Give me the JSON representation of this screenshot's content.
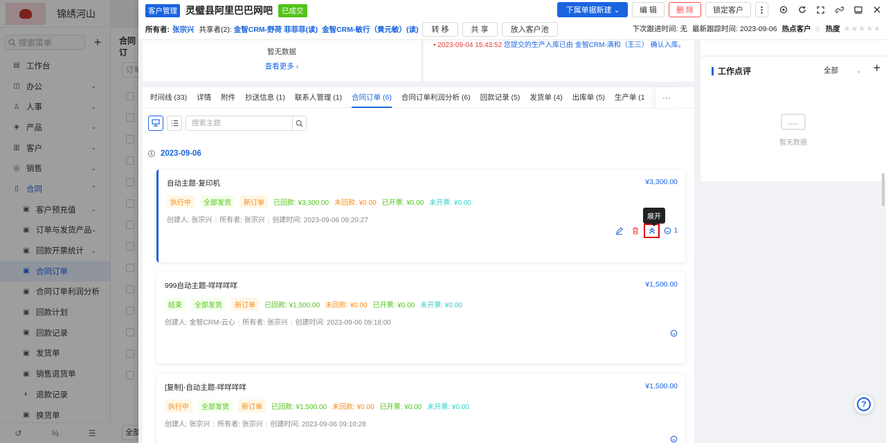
{
  "leftnav": {
    "brand": "锦绣河山",
    "search_placeholder": "搜索菜单",
    "items": [
      {
        "label": "工作台",
        "icon": "▤"
      },
      {
        "label": "办公",
        "icon": "◫",
        "chev": "⌄"
      },
      {
        "label": "人事",
        "icon": "♙",
        "chev": "⌄"
      },
      {
        "label": "产品",
        "icon": "◈",
        "chev": "⌄"
      },
      {
        "label": "客户",
        "icon": "▥",
        "chev": "⌄"
      },
      {
        "label": "销售",
        "icon": "◎",
        "chev": "⌄"
      },
      {
        "label": "合同",
        "icon": "▯",
        "chev": "⌃"
      },
      {
        "label": "客户预充值",
        "icon": "▣",
        "chev": "⌄"
      },
      {
        "label": "订单与发货产品",
        "icon": "▣",
        "chev": "⌄"
      },
      {
        "label": "回款开票统计",
        "icon": "▣",
        "chev": "⌄"
      },
      {
        "label": "合同订单",
        "icon": "▣"
      },
      {
        "label": "合同订单利润分析",
        "icon": "▣"
      },
      {
        "label": "回款计划",
        "icon": "▣"
      },
      {
        "label": "回款记录",
        "icon": "▣"
      },
      {
        "label": "发货单",
        "icon": "▣"
      },
      {
        "label": "销售退货单",
        "icon": "▣"
      },
      {
        "label": "退款记录",
        "icon": "◐"
      },
      {
        "label": "换货单",
        "icon": "▣"
      }
    ],
    "bottom": [
      "↺",
      "⅓",
      "☰"
    ]
  },
  "bg": {
    "title": "合同订",
    "search": "订单",
    "page": "全部"
  },
  "header": {
    "module_tag": "客户管理",
    "customer_name": "灵璧县阿里巴巴网吧",
    "status_tag": "已成交",
    "btn_new": "下属单据新建 ⌄",
    "btn_edit": "编 辑",
    "btn_delete": "删 除",
    "btn_lock": "锁定客户",
    "owner_label": "所有者:",
    "owner": "张宗兴",
    "shared_label": "共享者(2):",
    "shared1": "金智CRM-野荷 菲菲菲(读)",
    "shared2": "金智CRM-敏行（黄元敏）(读)",
    "btn_transfer": "转 移",
    "btn_share": "共 享",
    "btn_pool": "放入客户池",
    "next_follow_label": "下次跟进时间:",
    "next_follow": "无",
    "last_follow_label": "最新跟踪时间:",
    "last_follow": "2023-09-06",
    "hot_label": "热点客户",
    "heat_label": "热度"
  },
  "top_cards": {
    "nodata": "暂无数据",
    "more": "查看更多 ›",
    "log_time": "• 2023-09-04 15:43:52",
    "log_text1": "您提交的生产入库已由",
    "log_text2": "金智CRM-满和（王三）",
    "log_text3": "确认入库。"
  },
  "tabs": [
    "时间线 (33)",
    "详情",
    "附件",
    "抄送信息 (1)",
    "联系人管理 (1)",
    "合同订单 (6)",
    "合同订单利润分析 (6)",
    "回款记录 (5)",
    "发货单 (4)",
    "出库单 (5)",
    "生产单 (1"
  ],
  "toolbar": {
    "search_placeholder": "搜索主题"
  },
  "timeline": {
    "date": "2023-09-06"
  },
  "orders": [
    {
      "subject": "自动主题-复印机",
      "amount": "¥3,300.00",
      "status": "执行中",
      "ship": "全部发货",
      "type": "新订单",
      "received": "已回款: ¥3,300.00",
      "unreceived": "未回款: ¥0.00",
      "invoiced": "已开票: ¥0.00",
      "uninvoiced": "未开票: ¥0.00",
      "creator": "创建人: 张宗兴",
      "owner": "所有者: 张宗兴",
      "created": "创建时间: 2023-09-06 09:20:27",
      "comments": "1"
    },
    {
      "subject": "999自动主题-咩咩咩咩",
      "amount": "¥1,500.00",
      "status": "结束",
      "ship": "全部发货",
      "type": "新订单",
      "received": "已回款: ¥1,500.00",
      "unreceived": "未回款: ¥0.00",
      "invoiced": "已开票: ¥0.00",
      "uninvoiced": "未开票: ¥0.00",
      "creator": "创建人: 金智CRM-云心",
      "owner": "所有者: 张宗兴",
      "created": "创建时间: 2023-09-06 09:18:00"
    },
    {
      "subject": "[复制]-自动主题-咩咩咩咩",
      "amount": "¥1,500.00",
      "status": "执行中",
      "ship": "全部发货",
      "type": "新订单",
      "received": "已回款: ¥1,500.00",
      "unreceived": "未回款: ¥0.00",
      "invoiced": "已开票: ¥0.00",
      "uninvoiced": "未开票: ¥0.00",
      "creator": "创建人: 张宗兴",
      "owner": "所有者: 张宗兴",
      "created": "创建时间: 2023-09-06 09:10:28"
    }
  ],
  "tooltip": "展开",
  "right_panel": {
    "title": "工作点评",
    "filter": "全部",
    "empty": "暂无数据"
  },
  "colors": {
    "accent": "#1a64e0",
    "danger": "#ff4d4f",
    "success": "#52c41a",
    "warning": "#fa8c16"
  }
}
